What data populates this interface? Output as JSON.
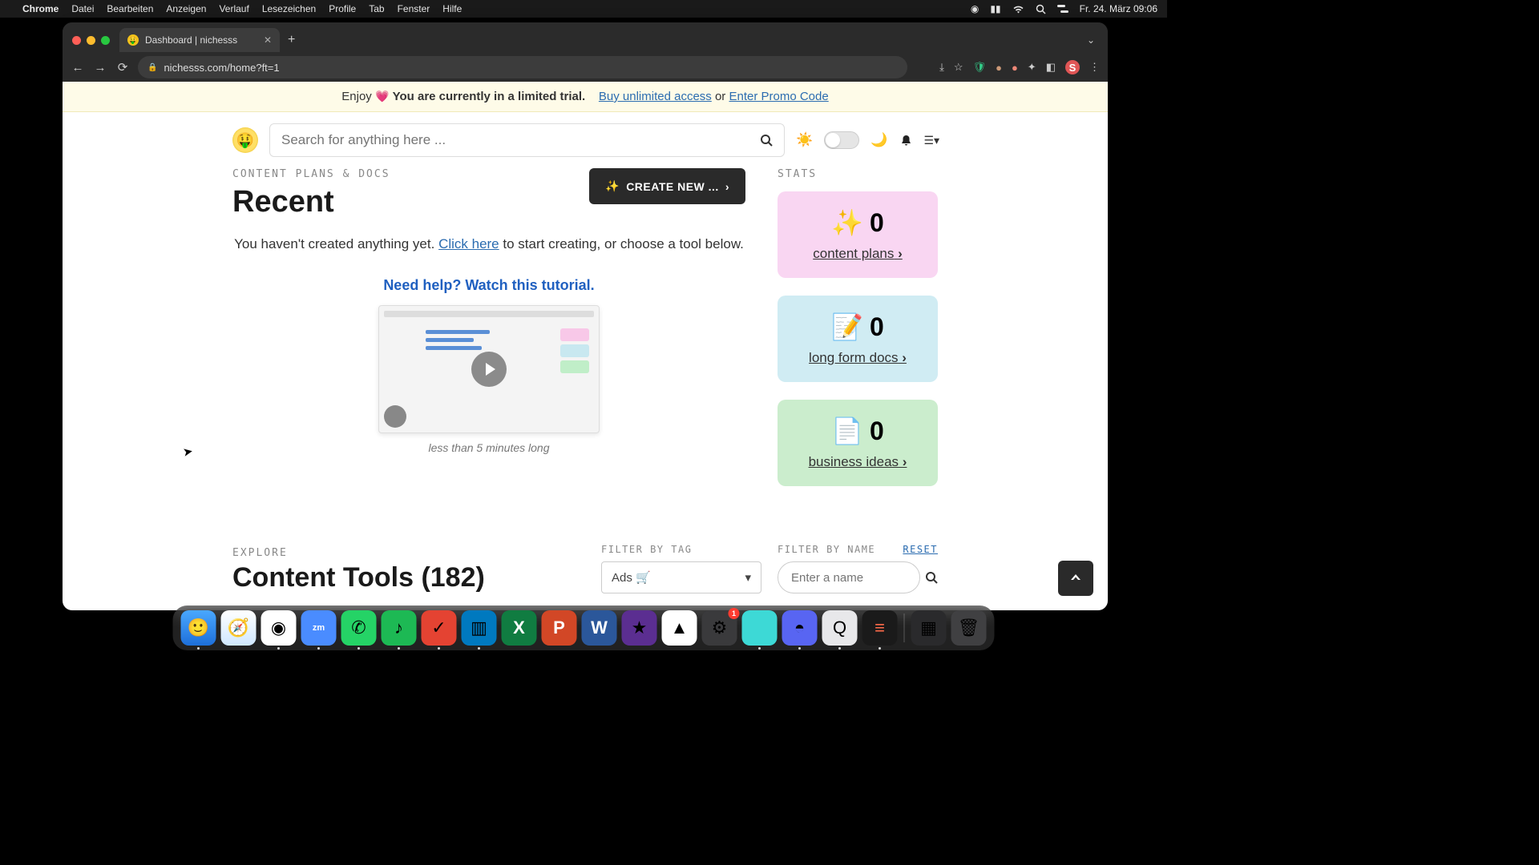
{
  "menubar": {
    "app": "Chrome",
    "items": [
      "Datei",
      "Bearbeiten",
      "Anzeigen",
      "Verlauf",
      "Lesezeichen",
      "Profile",
      "Tab",
      "Fenster",
      "Hilfe"
    ],
    "clock": "Fr. 24. März  09:06"
  },
  "tab": {
    "title": "Dashboard | nichesss"
  },
  "url": "nichesss.com/home?ft=1",
  "banner": {
    "prefix": "Enjoy ",
    "bold": "You are currently in a limited trial.",
    "buy": "Buy unlimited access",
    "or": " or ",
    "promo": "Enter Promo Code"
  },
  "search": {
    "placeholder": "Search for anything here ..."
  },
  "sections": {
    "eyebrow1": "CONTENT PLANS & DOCS",
    "recent": "Recent",
    "create": "CREATE NEW ...",
    "empty1": "You haven't created anything yet. ",
    "clickhere": "Click here",
    "empty2": " to start creating, or choose a tool below.",
    "help": "Need help? Watch this tutorial.",
    "vidcap": "less than 5 minutes long",
    "stats": "STATS"
  },
  "stats": [
    {
      "emoji": "✨",
      "value": "0",
      "label": "content plans"
    },
    {
      "emoji": "📝",
      "value": "0",
      "label": "long form docs"
    },
    {
      "emoji": "📄",
      "value": "0",
      "label": "business ideas"
    }
  ],
  "explore": {
    "eyebrow": "EXPLORE",
    "heading": "Content Tools (182)",
    "filterTag": "FILTER BY TAG",
    "tagValue": "Ads 🛒",
    "filterName": "FILTER BY NAME",
    "reset": "Reset",
    "namePlaceholder": "Enter a name"
  },
  "ext": {
    "avatar": "S"
  },
  "dock": {
    "badge": "1"
  }
}
